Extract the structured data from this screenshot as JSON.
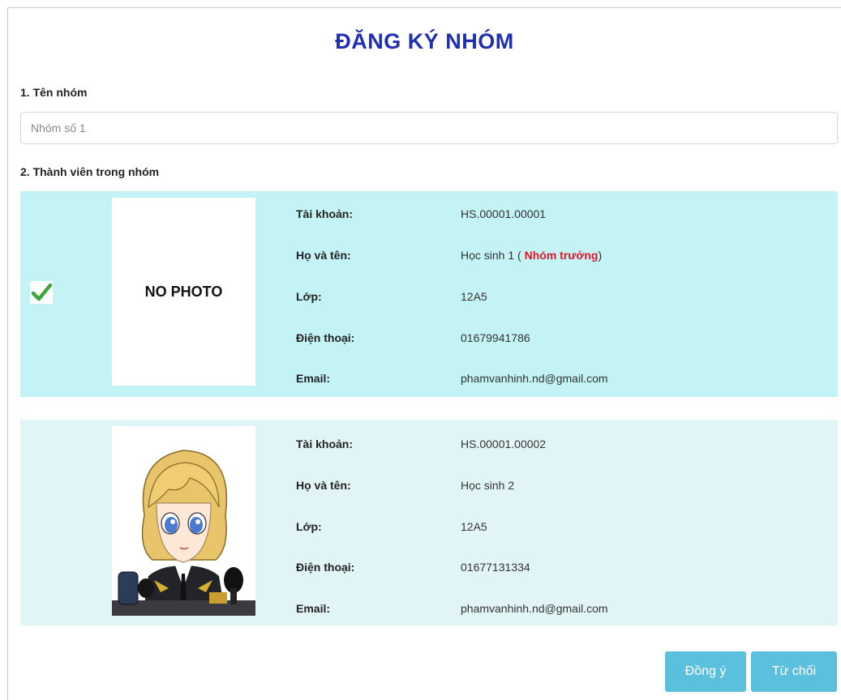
{
  "title": "ĐĂNG KÝ NHÓM",
  "section1": {
    "label": "1. Tên nhóm",
    "input_placeholder": "Nhóm số 1",
    "input_value": ""
  },
  "section2": {
    "label": "2. Thành viên trong nhóm"
  },
  "field_labels": {
    "account": "Tài khoản:",
    "fullname": "Họ và tên:",
    "class": "Lớp:",
    "phone": "Điện thoại:",
    "email": "Email:"
  },
  "members": [
    {
      "selected": true,
      "photo_text": "NO PHOTO",
      "account": "HS.00001.00001",
      "fullname": "Học sinh 1",
      "role_prefix": " ( ",
      "role": "Nhóm trưởng",
      "role_suffix": ")",
      "class": "12A5",
      "phone": "01679941786",
      "email": "phamvanhinh.nd@gmail.com",
      "row_color": "#c4f3f6"
    },
    {
      "selected": false,
      "photo_icon": "anime-avatar-photo",
      "account": "HS.00001.00002",
      "fullname": "Học sinh 2",
      "class": "12A5",
      "phone": "01677131334",
      "email": "phamvanhinh.nd@gmail.com",
      "row_color": "#e2f5f6"
    }
  ],
  "buttons": {
    "agree": "Đồng ý",
    "reject": "Từ chối"
  },
  "colors": {
    "title": "#1f2fb0",
    "button": "#5bc0de",
    "leader": "#e0162b",
    "check": "#3aa83a"
  }
}
